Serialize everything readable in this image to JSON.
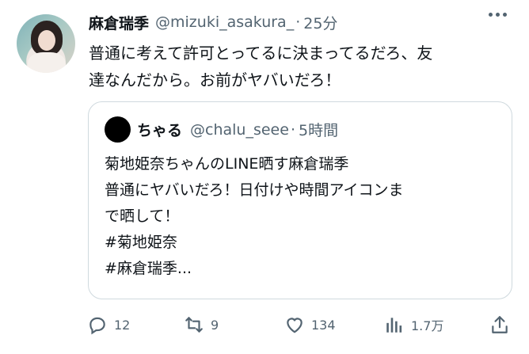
{
  "tweet": {
    "author_name": "麻倉瑞季",
    "author_handle": "@mizuki_asakura_",
    "dot": "·",
    "time": "25分",
    "text_lines": [
      "普通に考えて許可とってるに決まってるだろ、友",
      "達なんだから。お前がヤバいだろ！"
    ]
  },
  "quoted_tweet": {
    "author_name": "ちゃる",
    "author_handle": "@chalu_seee",
    "dot": "·",
    "time": "5時間",
    "text_lines": [
      "菊地姫奈ちゃんのLINE晒す麻倉瑞季",
      "普通にヤバいだろ！日付けや時間アイコンま",
      "で晒して！",
      "#菊地姫奈",
      "#麻倉瑞季..."
    ]
  },
  "actions": {
    "replies": "12",
    "retweets": "9",
    "likes": "134",
    "views": "1.7万"
  },
  "icons": {
    "reply": "reply-icon",
    "retweet": "retweet-icon",
    "like": "heart-icon",
    "views": "views-icon",
    "share": "share-icon",
    "more": "more-icon"
  },
  "colors": {
    "text": "#0f1419",
    "secondary": "#536471",
    "border": "#cfd9de"
  }
}
